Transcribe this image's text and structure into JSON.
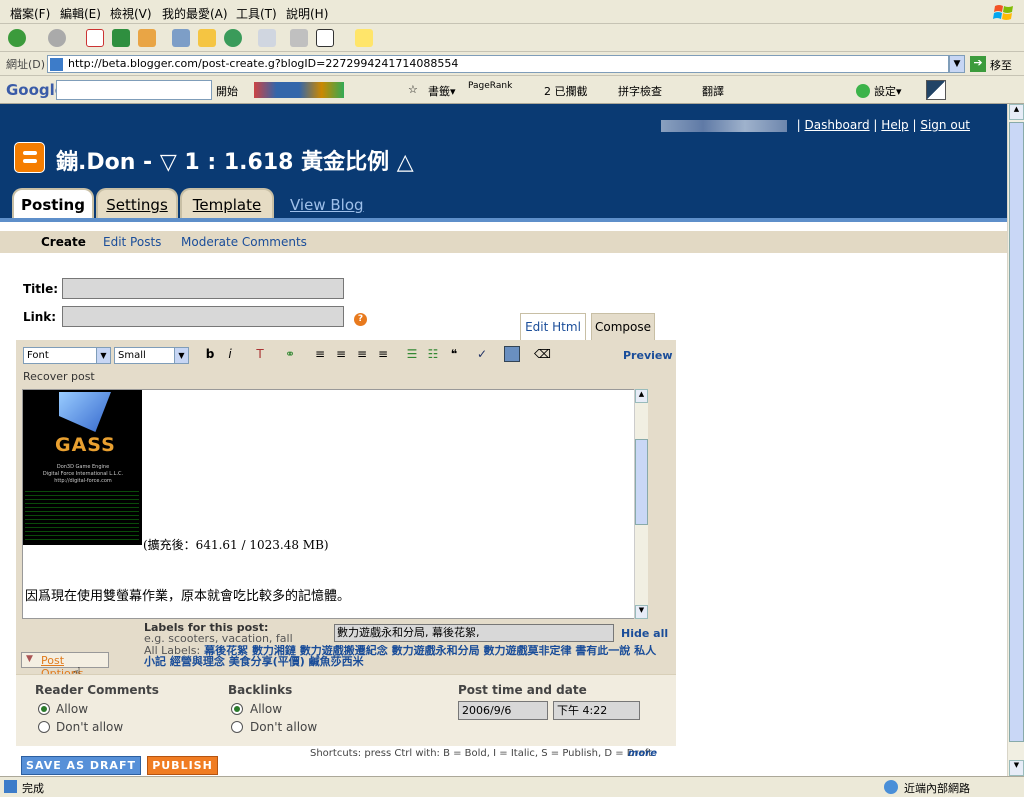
{
  "menu": [
    "檔案(F)",
    "編輯(E)",
    "檢視(V)",
    "我的最愛(A)",
    "工具(T)",
    "說明(H)"
  ],
  "address": {
    "label": "網址(D)",
    "url": "http://beta.blogger.com/post-create.g?blogID=2272994241714088554",
    "go": "移至"
  },
  "googlebar": {
    "logo": "Google",
    "start": "開始",
    "bookmarks": "書籤▾",
    "pagerank": "PageRank",
    "blocked": "2 已攔截",
    "spell": "拼字檢查",
    "translate": "翻譯",
    "settings": "設定▾"
  },
  "header": {
    "blog_title": "鏰.Don - ▽ 1 : 1.618 黃金比例 △",
    "dashboard": "Dashboard",
    "help": "Help",
    "signout": "Sign out",
    "sep": "|"
  },
  "tabs": {
    "posting": "Posting",
    "settings": "Settings",
    "template": "Template",
    "viewblog": "View Blog"
  },
  "subnav": {
    "create": "Create",
    "edit": "Edit Posts",
    "moderate": "Moderate Comments"
  },
  "form": {
    "title_label": "Title:",
    "link_label": "Link:",
    "help_q": "?"
  },
  "editor": {
    "edit_html": "Edit Html",
    "compose": "Compose",
    "font": "Font",
    "size": "Small",
    "preview": "Preview",
    "recover": "Recover post",
    "ss_gass": "GASS",
    "ss_lines": [
      "Don3D Game Engine",
      "Digital Force International L.L.C.",
      "http://digital-force.com"
    ],
    "memtext": "(擴充後：641.61 / 1023.48 MB)",
    "paragraph": "因爲現在使用雙螢幕作業，原本就會吃比較多的記憶體。"
  },
  "labels": {
    "title": "Labels for this post:",
    "hint": "e.g. scooters, vacation, fall",
    "value": "數力遊戲永和分局, 幕後花絮,",
    "hide": "Hide all",
    "all_prefix": "All Labels:",
    "all": [
      "幕後花絮",
      "數力湘鏈",
      "數力遊戲搬遷紀念",
      "數力遊戲永和分局",
      "數力遊戲莫非定律",
      "書有此一說",
      "私人小記",
      "經營與理念",
      "美食分享(平價)",
      "鹹魚莎西米"
    ]
  },
  "postopts": {
    "toggle": "Post Options",
    "reader": "Reader Comments",
    "backlinks": "Backlinks",
    "allow": "Allow",
    "dont": "Don't allow",
    "time_label": "Post time and date",
    "date": "2006/9/6",
    "time": "下午 4:22"
  },
  "buttons": {
    "draft": "SAVE AS DRAFT",
    "publish": "PUBLISH"
  },
  "shortcuts": "Shortcuts: press Ctrl with: B = Bold, I = Italic, S = Publish, D = Draft",
  "more": "more",
  "status": {
    "left": "完成",
    "zone": "近端內部網路"
  }
}
